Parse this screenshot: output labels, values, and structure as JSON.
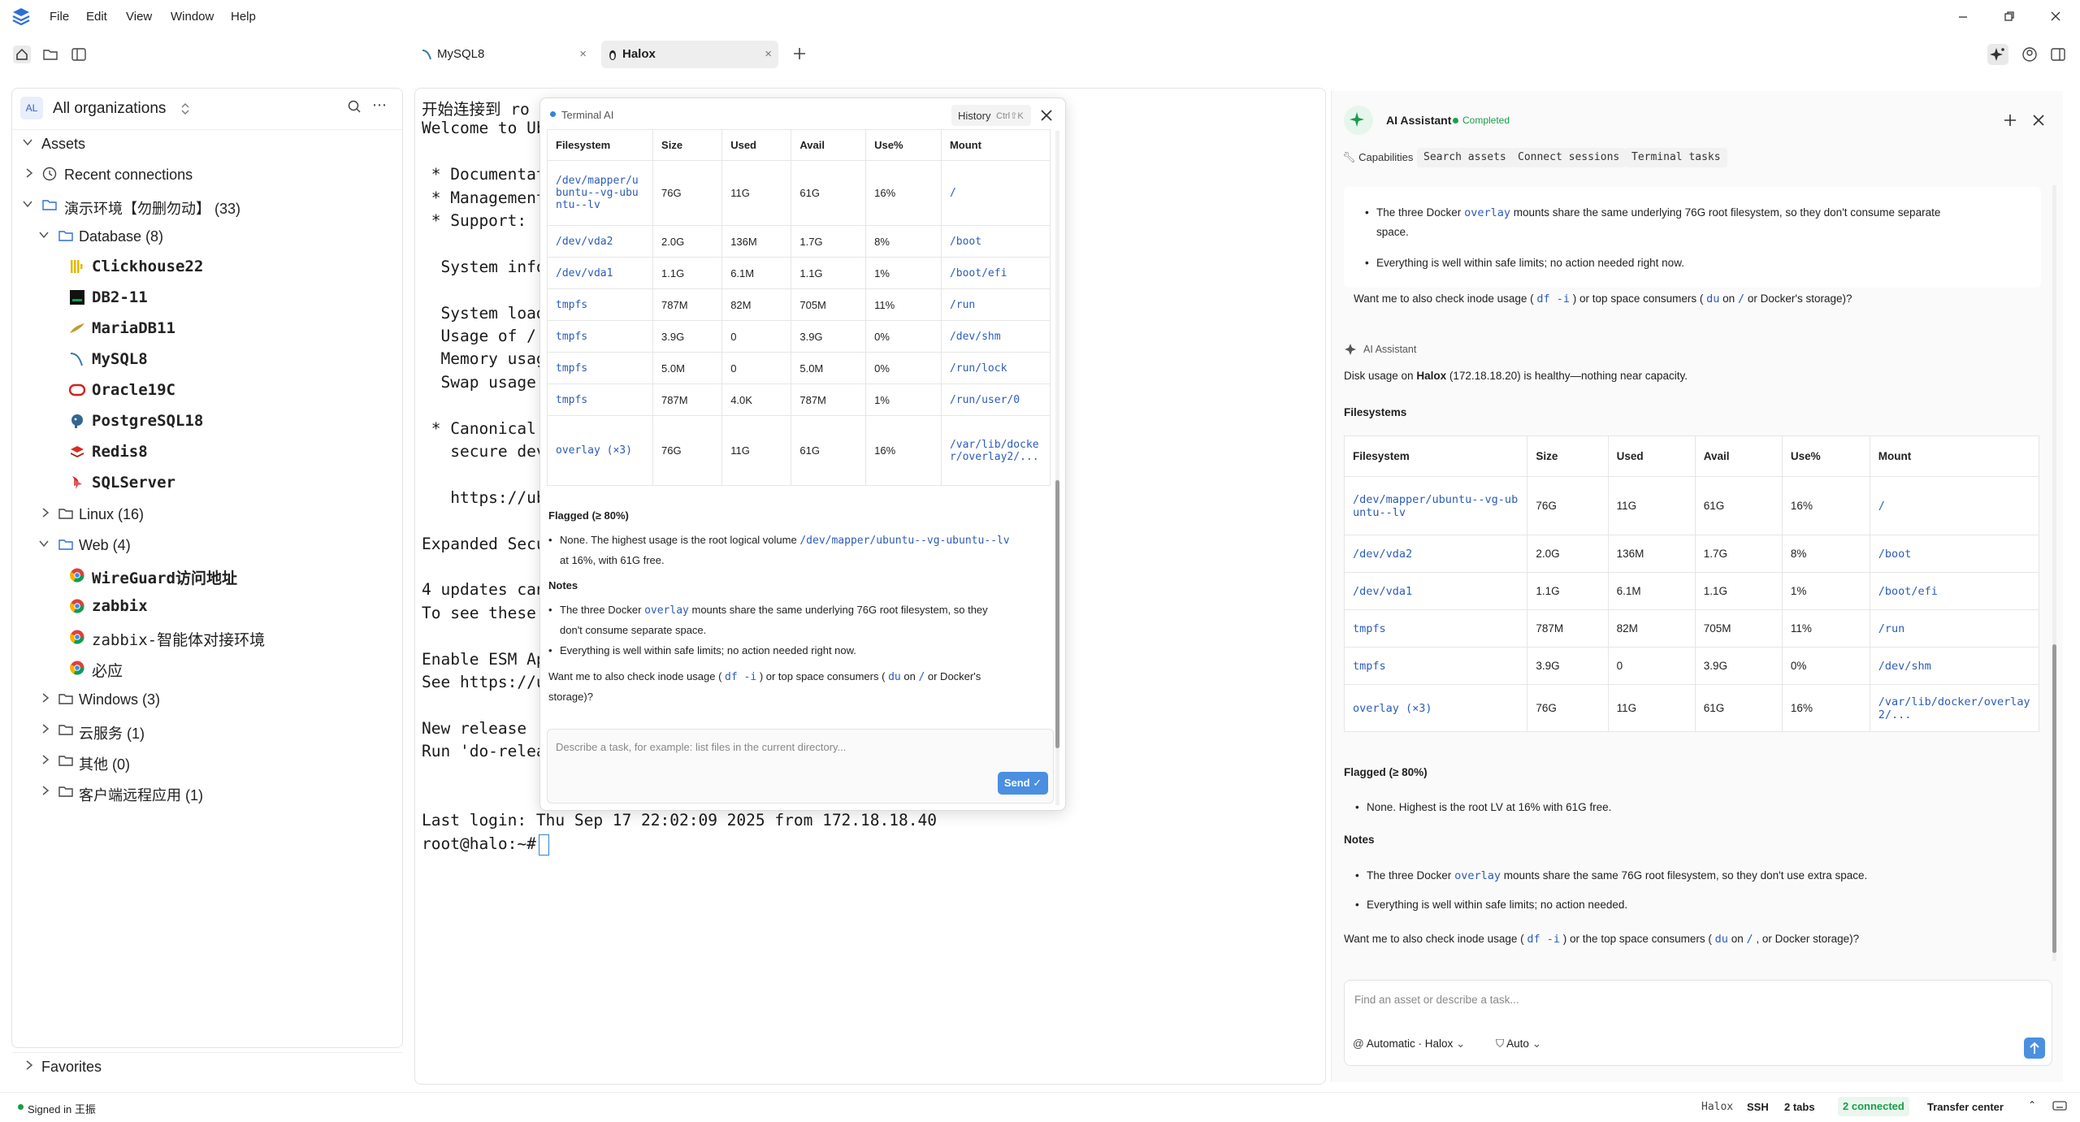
{
  "menu": {
    "items": [
      "File",
      "Edit",
      "View",
      "Window",
      "Help"
    ]
  },
  "tabs": [
    {
      "label": "MySQL8",
      "close": "×"
    },
    {
      "label": "Halox",
      "close": "×"
    }
  ],
  "org": {
    "avatar": "AL",
    "label": "All organizations"
  },
  "tree": {
    "assets": "Assets",
    "recent": "Recent connections",
    "env": "演示环境【勿删勿动】 (33)",
    "database": "Database (8)",
    "db_items": [
      "Clickhouse22",
      "DB2-11",
      "MariaDB11",
      "MySQL8",
      "Oracle19C",
      "PostgreSQL18",
      "Redis8",
      "SQLServer"
    ],
    "linux": "Linux (16)",
    "web": "Web (4)",
    "web_items": [
      "WireGuard访问地址",
      "zabbix",
      "zabbix-智能体对接环境",
      "必应"
    ],
    "windows": "Windows (3)",
    "cloud": "云服务 (1)",
    "other": "其他 (0)",
    "client": "客户端远程应用 (1)",
    "favorites": "Favorites"
  },
  "terminal": {
    "lines": [
      "开始连接到 ro",
      "Welcome to Ub",
      "",
      " * Documentat",
      " * Management",
      " * Support:",
      "",
      "  System infor",
      "",
      "  System load",
      "  Usage of /:",
      "  Memory usag",
      "  Swap usage:",
      "",
      " * Canonical                                         nd",
      "   secure dev",
      "",
      "   https://ub",
      "",
      "Expanded Secu",
      "",
      "4 updates can",
      "To see these",
      "",
      "Enable ESM Ap",
      "See https://u",
      "",
      "New release '",
      "Run 'do-relea",
      "",
      "",
      "Last login: Thu Sep 17 22:02:09 2025 from 172.18.18.40",
      "root@halo:~# "
    ]
  },
  "term_ai": {
    "title": "Terminal AI",
    "history": "History",
    "shortcut": "Ctrl⇧K",
    "columns": [
      "Filesystem",
      "Size",
      "Used",
      "Avail",
      "Use%",
      "Mount"
    ],
    "rows": [
      [
        "/dev/mapper/ubuntu--vg-ubuntu--lv",
        "76G",
        "11G",
        "61G",
        "16%",
        "/"
      ],
      [
        "/dev/vda2",
        "2.0G",
        "136M",
        "1.7G",
        "8%",
        "/boot"
      ],
      [
        "/dev/vda1",
        "1.1G",
        "6.1M",
        "1.1G",
        "1%",
        "/boot/efi"
      ],
      [
        "tmpfs",
        "787M",
        "82M",
        "705M",
        "11%",
        "/run"
      ],
      [
        "tmpfs",
        "3.9G",
        "0",
        "3.9G",
        "0%",
        "/dev/shm"
      ],
      [
        "tmpfs",
        "5.0M",
        "0",
        "5.0M",
        "0%",
        "/run/lock"
      ],
      [
        "tmpfs",
        "787M",
        "4.0K",
        "787M",
        "1%",
        "/run/user/0"
      ],
      [
        "overlay (×3)",
        "76G",
        "11G",
        "61G",
        "16%",
        "/var/lib/docker/overlay2/..."
      ]
    ],
    "flagged_title": "Flagged (≥ 80%)",
    "flagged_a": "None. The highest usage is the root logical volume",
    "flagged_code": "/dev/mapper/ubuntu--vg-ubuntu--lv",
    "flagged_b": "at 16%, with 61G free.",
    "notes_title": "Notes",
    "note1_a": "The three Docker",
    "note1_code": "overlay",
    "note1_b": "mounts share the same underlying 76G root filesystem, so they",
    "note1_c": "don't consume separate space.",
    "note2": "Everything is well within safe limits; no action needed right now.",
    "ask_a": "Want me to also check inode usage (",
    "ask_code1": "df -i",
    "ask_b": ") or top space consumers (",
    "ask_code2": "du",
    "ask_c": "on",
    "ask_code3": "/",
    "ask_d": "or Docker's",
    "ask_e": "storage)?",
    "input_placeholder": "Describe a task, for example: list files in the current directory...",
    "send": "Send"
  },
  "ai_panel": {
    "title": "AI Assistant",
    "status": "Completed",
    "chips": [
      "Capabilities",
      "Search assets",
      "Connect sessions",
      "Terminal tasks"
    ],
    "prev_b1_a": "The three Docker",
    "prev_b1_code": "overlay",
    "prev_b1_b": "mounts share the same underlying 76G root filesystem, so they don't consume separate",
    "prev_b1_c": "space.",
    "prev_b2": "Everything is well within safe limits; no action needed right now.",
    "prev_ask_a": "Want me to also check inode usage (",
    "prev_ask_code1": "df -i",
    "prev_ask_b": ") or top space consumers (",
    "prev_ask_code2": "du",
    "prev_ask_c": "on",
    "prev_ask_code3": "/",
    "prev_ask_d": "or Docker's storage)?",
    "msg_label": "AI Assistant",
    "summary_a": "Disk usage on",
    "summary_host": "Halox",
    "summary_b": "(172.18.18.20) is healthy—nothing near capacity.",
    "fs_title": "Filesystems",
    "columns": [
      "Filesystem",
      "Size",
      "Used",
      "Avail",
      "Use%",
      "Mount"
    ],
    "rows": [
      [
        "/dev/mapper/ubuntu--vg-ubuntu--lv",
        "76G",
        "11G",
        "61G",
        "16%",
        "/"
      ],
      [
        "/dev/vda2",
        "2.0G",
        "136M",
        "1.7G",
        "8%",
        "/boot"
      ],
      [
        "/dev/vda1",
        "1.1G",
        "6.1M",
        "1.1G",
        "1%",
        "/boot/efi"
      ],
      [
        "tmpfs",
        "787M",
        "82M",
        "705M",
        "11%",
        "/run"
      ],
      [
        "tmpfs",
        "3.9G",
        "0",
        "3.9G",
        "0%",
        "/dev/shm"
      ],
      [
        "overlay (×3)",
        "76G",
        "11G",
        "61G",
        "16%",
        "/var/lib/docker/overlay2/..."
      ]
    ],
    "flagged_title": "Flagged (≥ 80%)",
    "flagged": "None. Highest is the root LV at 16% with 61G free.",
    "notes_title": "Notes",
    "note1_a": "The three Docker",
    "note1_code": "overlay",
    "note1_b": "mounts share the same 76G root filesystem, so they don't use extra space.",
    "note2": "Everything is well within safe limits; no action needed.",
    "ask_a": "Want me to also check inode usage (",
    "ask_code1": "df -i",
    "ask_b": ") or the top space consumers (",
    "ask_code2": "du",
    "ask_c": "on",
    "ask_code3": "/",
    "ask_d": ", or Docker storage)?",
    "input_placeholder": "Find an asset or describe a task...",
    "mode": "Automatic · Halox",
    "auto": "Auto"
  },
  "status": {
    "signed_in": "Signed in 王振",
    "host": "Halox",
    "proto": "SSH",
    "tabs": "2 tabs",
    "connected": "2 connected",
    "transfer": "Transfer center"
  },
  "colors": {
    "accent": "#2d86d6",
    "green": "#1a9d4a",
    "code": "#2b5cb8"
  }
}
